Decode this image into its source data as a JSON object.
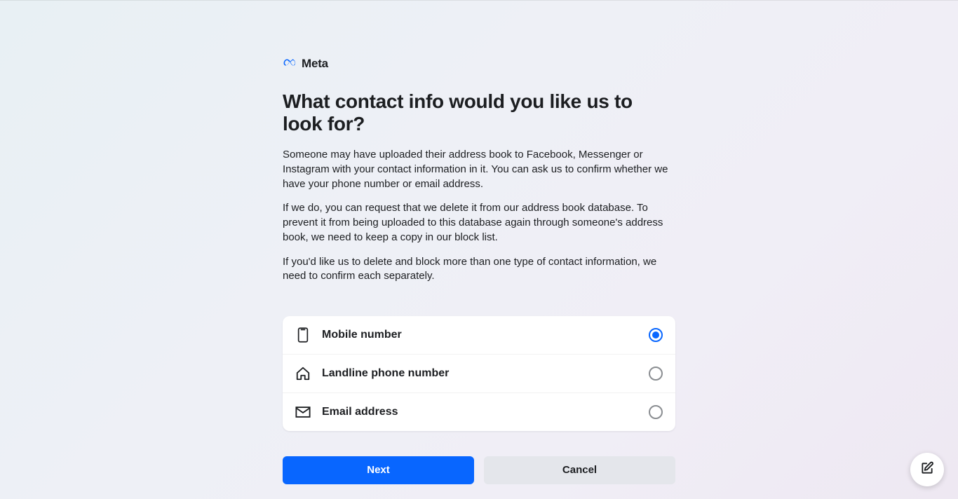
{
  "brand": "Meta",
  "heading": "What contact info would you like us to look for?",
  "paragraphs": [
    "Someone may have uploaded their address book to Facebook, Messenger or Instagram with your contact information in it. You can ask us to confirm whether we have your phone number or email address.",
    "If we do, you can request that we delete it from our address book database. To prevent it from being uploaded to this database again through someone's address book, we need to keep a copy in our block list.",
    "If you'd like us to delete and block more than one type of contact information, we need to confirm each separately."
  ],
  "options": [
    {
      "label": "Mobile number",
      "selected": true
    },
    {
      "label": "Landline phone number",
      "selected": false
    },
    {
      "label": "Email address",
      "selected": false
    }
  ],
  "buttons": {
    "next": "Next",
    "cancel": "Cancel"
  }
}
